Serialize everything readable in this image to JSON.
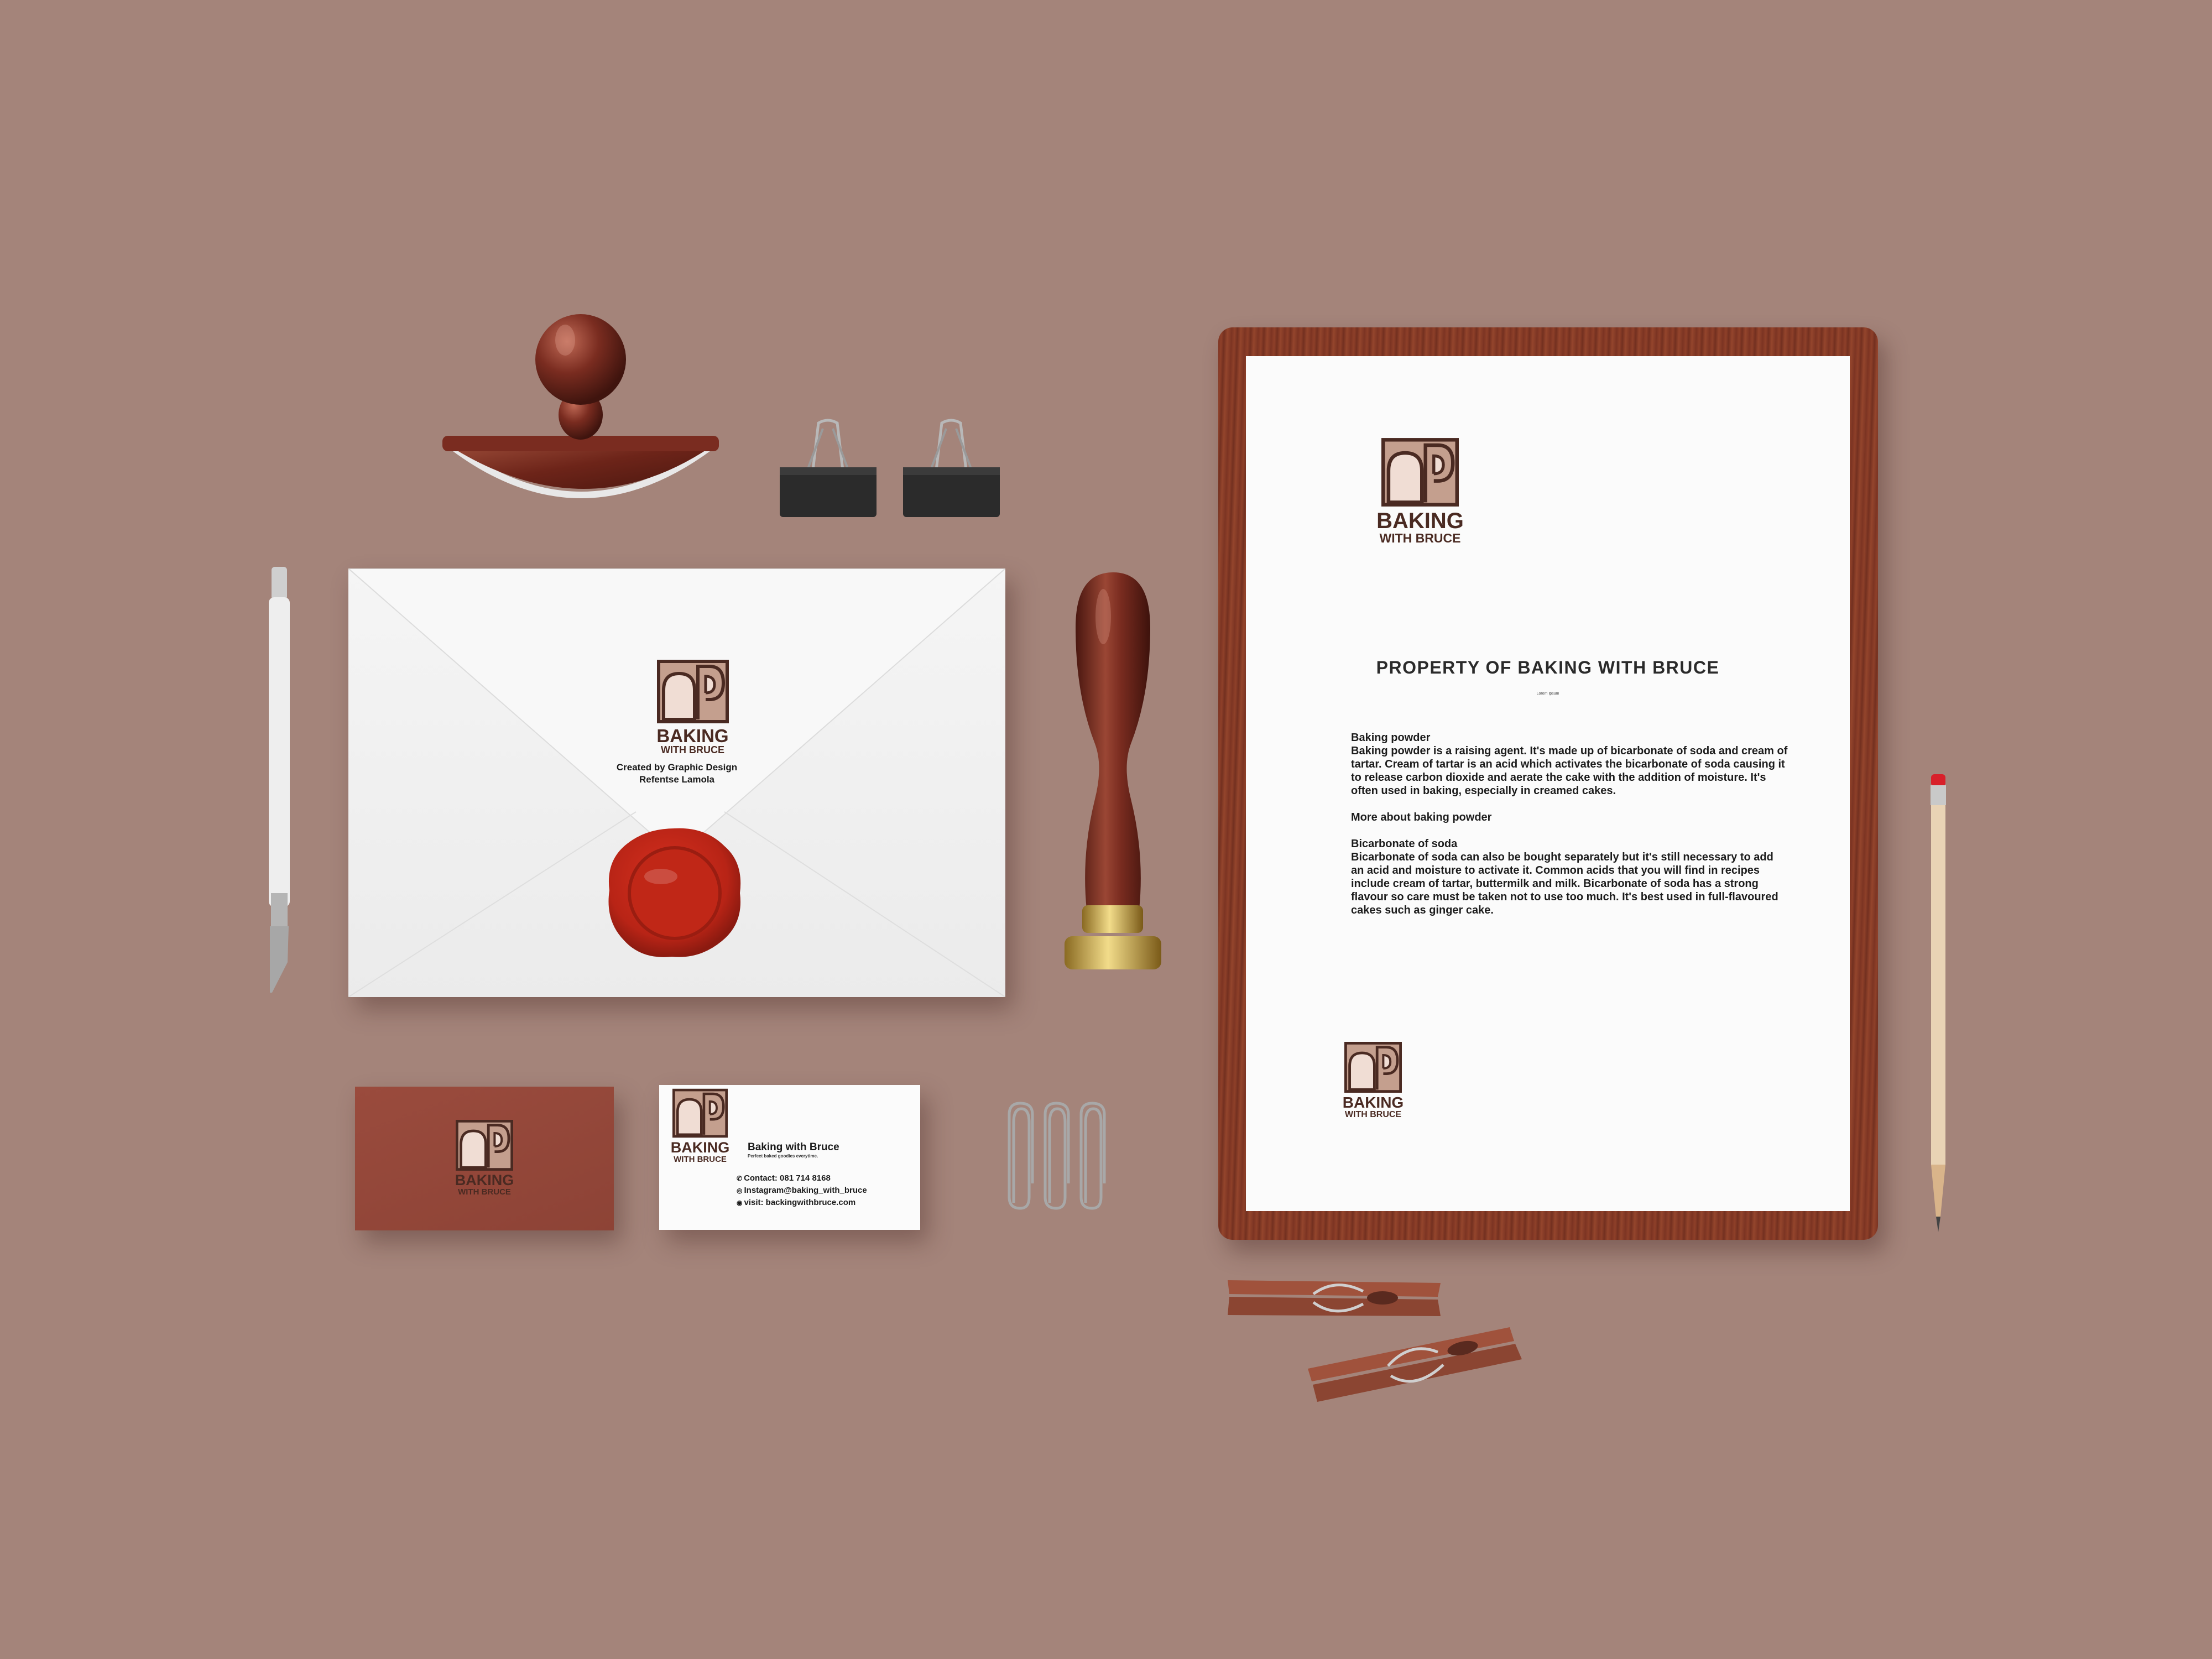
{
  "scene": {
    "description_colors": {
      "background": "#a4847a",
      "brand_brown": "#4a2a22",
      "logo_tan": "#c49f8e",
      "logo_cream": "#f0ddd4",
      "wood": "#7b3322",
      "wax": "#c8281c",
      "card_red": "#9a4b3d"
    }
  },
  "brand": {
    "name_line1": "BAKING",
    "name_line2": "WITH BRUCE",
    "icon": "bread-arch-logo-icon"
  },
  "envelope": {
    "credit_line1": "Created by Graphic Design",
    "credit_line2": "Refentse Lamola"
  },
  "letter": {
    "title": "PROPERTY OF BAKING WITH BRUCE",
    "subtitle": "Lorem Ipsum",
    "section1_heading": "Baking powder",
    "section1_body": "Baking powder is a raising agent. It's made up of bicarbonate of soda and cream of tartar. Cream of tartar is an acid which activates the bicarbonate of soda causing it to release carbon dioxide and aerate the cake with the addition of moisture. It's often used in baking, especially in creamed cakes.",
    "section2_heading": "More about baking powder",
    "section3_heading": "Bicarbonate of soda",
    "section3_body": "Bicarbonate of soda can also be bought separately but it's still necessary to add an acid and moisture to activate it. Common acids that you will find in recipes include cream of tartar, buttermilk and milk. Bicarbonate of soda has a strong flavour so care must be taken not to use too much. It's best used in full-flavoured cakes such as ginger cake."
  },
  "business_card": {
    "name": "Baking with Bruce",
    "tagline": "Perfect baked goodies everytime.",
    "contact": "Contact: 081 714 8168",
    "instagram": "Instagram@baking_with_bruce",
    "website": "visit: backingwithbruce.com",
    "contact_icon": "phone-icon",
    "instagram_icon": "instagram-icon",
    "website_icon": "globe-icon"
  }
}
